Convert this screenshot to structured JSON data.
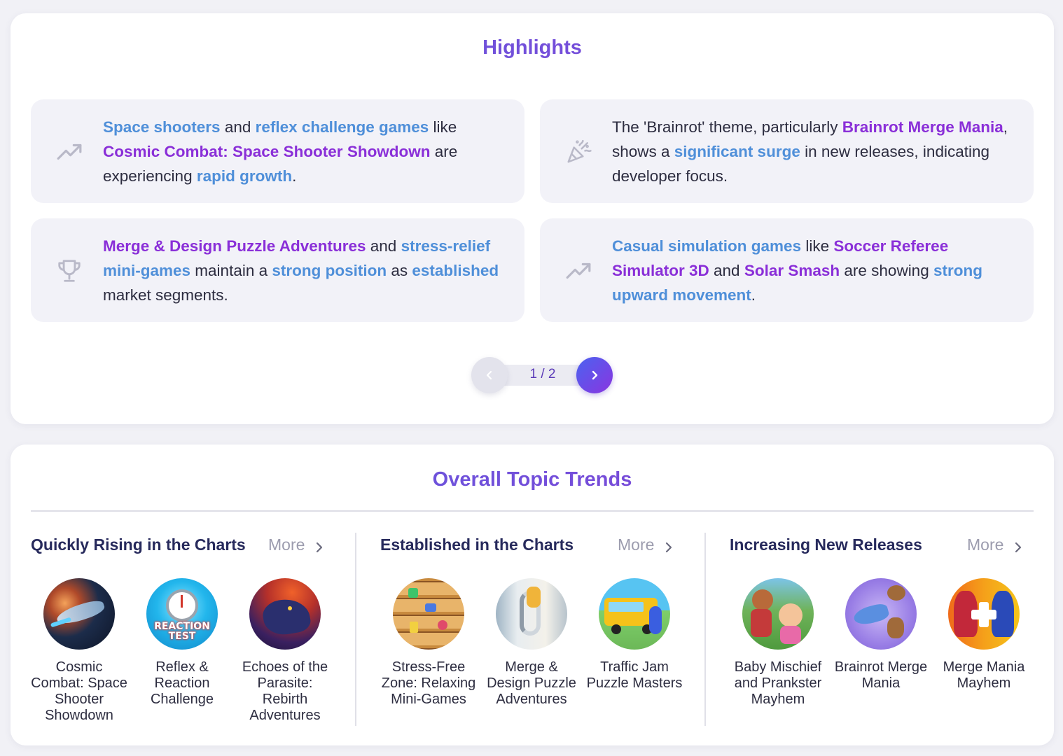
{
  "highlights": {
    "title": "Highlights",
    "tiles": [
      {
        "icon": "trending-up-icon",
        "segments": [
          {
            "t": "Space shooters",
            "s": "b"
          },
          {
            "t": " and ",
            "s": ""
          },
          {
            "t": "reflex challenge games",
            "s": "b"
          },
          {
            "t": " like ",
            "s": ""
          },
          {
            "t": "Cosmic Combat: Space Shooter Showdown",
            "s": "p"
          },
          {
            "t": " are experiencing ",
            "s": ""
          },
          {
            "t": "rapid growth",
            "s": "b"
          },
          {
            "t": ".",
            "s": ""
          }
        ]
      },
      {
        "icon": "party-popper-icon",
        "segments": [
          {
            "t": "The 'Brainrot' theme, particularly ",
            "s": ""
          },
          {
            "t": "Brainrot Merge Mania",
            "s": "p"
          },
          {
            "t": ", shows a ",
            "s": ""
          },
          {
            "t": "significant surge",
            "s": "b"
          },
          {
            "t": " in new releases, indicating developer focus.",
            "s": ""
          }
        ]
      },
      {
        "icon": "trophy-icon",
        "segments": [
          {
            "t": "Merge & Design Puzzle Adventures",
            "s": "p"
          },
          {
            "t": " and ",
            "s": ""
          },
          {
            "t": "stress-relief mini-games",
            "s": "b"
          },
          {
            "t": " maintain a ",
            "s": ""
          },
          {
            "t": "strong position",
            "s": "b"
          },
          {
            "t": " as ",
            "s": ""
          },
          {
            "t": "established",
            "s": "b"
          },
          {
            "t": " market segments.",
            "s": ""
          }
        ]
      },
      {
        "icon": "trending-up-icon",
        "segments": [
          {
            "t": "Casual simulation games",
            "s": "b"
          },
          {
            "t": " like ",
            "s": ""
          },
          {
            "t": "Soccer Referee Simulator 3D",
            "s": "p"
          },
          {
            "t": " and ",
            "s": ""
          },
          {
            "t": "Solar Smash",
            "s": "p"
          },
          {
            "t": " are showing ",
            "s": ""
          },
          {
            "t": "strong upward movement",
            "s": "b"
          },
          {
            "t": ".",
            "s": ""
          }
        ]
      }
    ],
    "pager": {
      "label": "1 / 2",
      "prev_icon": "chevron-left-icon",
      "next_icon": "chevron-right-icon"
    }
  },
  "trends": {
    "title": "Overall Topic Trends",
    "columns": [
      {
        "title": "Quickly Rising in the Charts",
        "more_label": "More",
        "games": [
          {
            "name": "Cosmic Combat: Space Shooter Showdown"
          },
          {
            "name": "Reflex & Reaction Challenge",
            "thumb_text": "REACTION TEST"
          },
          {
            "name": "Echoes of the Parasite: Rebirth Adventures"
          }
        ]
      },
      {
        "title": "Established in the Charts",
        "more_label": "More",
        "games": [
          {
            "name": "Stress-Free Zone: Relaxing Mini-Games"
          },
          {
            "name": "Merge & Design Puzzle Adventures"
          },
          {
            "name": "Traffic Jam Puzzle Masters"
          }
        ]
      },
      {
        "title": "Increasing New Releases",
        "more_label": "More",
        "games": [
          {
            "name": "Baby Mischief and Prankster Mayhem"
          },
          {
            "name": "Brainrot Merge Mania"
          },
          {
            "name": "Merge Mania Mayhem"
          }
        ]
      }
    ]
  },
  "colors": {
    "accent_blue": "#4f8fd9",
    "accent_purple": "#8a2fd8",
    "title_gradient_start": "#5b5fe0",
    "title_gradient_end": "#8a3fd4"
  }
}
